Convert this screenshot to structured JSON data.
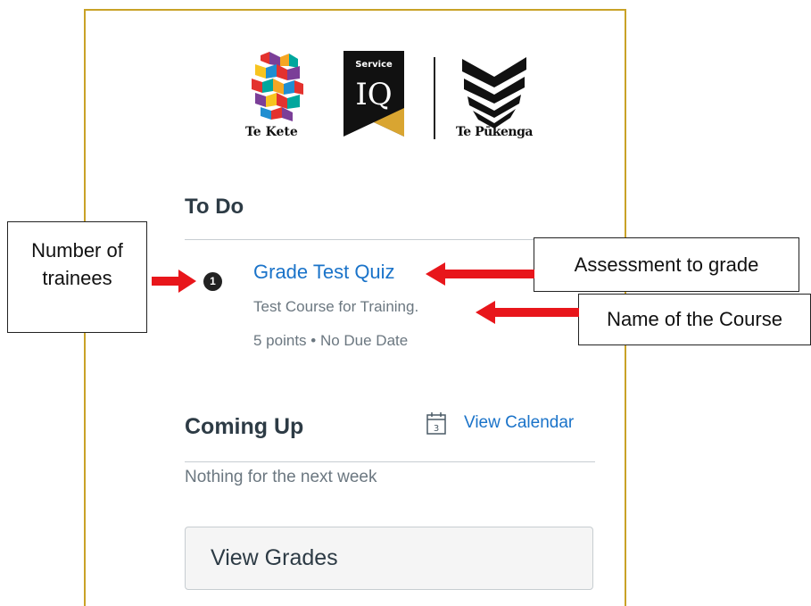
{
  "logos": {
    "tekete_label": "Te Kete",
    "iq_top": "Service",
    "iq_main": "IQ",
    "tp_label": "Te Pūkenga"
  },
  "todo": {
    "heading": "To Do",
    "badge_count": "1",
    "item_title": "Grade Test Quiz",
    "item_course": "Test Course for Training.",
    "item_meta": "5 points • No Due Date"
  },
  "coming_up": {
    "heading": "Coming Up",
    "view_calendar": "View Calendar",
    "calendar_icon_day": "3",
    "empty_text": "Nothing for the next week"
  },
  "view_grades_label": "View Grades",
  "annotations": {
    "trainees": "Number of trainees",
    "assessment": "Assessment to grade",
    "course": "Name of the Course"
  },
  "colors": {
    "link": "#1a73c9",
    "arrow": "#e8161b",
    "panel_border": "#c9a227",
    "iq_gold": "#d9a531"
  }
}
